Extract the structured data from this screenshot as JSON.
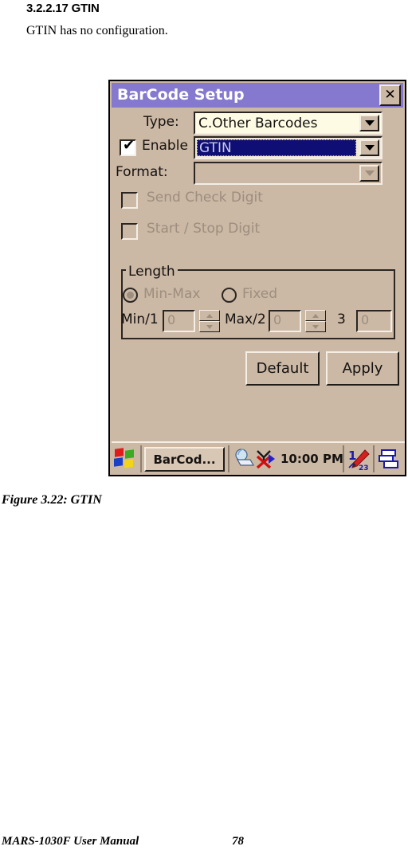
{
  "document": {
    "heading": "3.2.2.17 GTIN",
    "paragraph": "GTIN has no configuration.",
    "figure_caption": "Figure 3.22:  GTIN",
    "footer_left": "MARS-1030F User Manual",
    "footer_page": "78"
  },
  "dialog": {
    "title": "BarCode Setup",
    "close_label": "✕",
    "accent_titlebar": "#8578CF",
    "face_color": "#CBB8A5",
    "field_color": "#FDFBE3",
    "selection_color": "#0E0E74",
    "type": {
      "label": "Type:",
      "value": "C.Other Barcodes",
      "dropdown_icon": "chevron-down-icon"
    },
    "enable": {
      "label": "Enable",
      "checked": true,
      "check_glyph": "✔",
      "value": "GTIN",
      "dropdown_icon": "chevron-down-icon"
    },
    "format": {
      "label": "Format:",
      "value": "",
      "dropdown_icon": "chevron-down-icon",
      "disabled": true
    },
    "checkboxes": [
      {
        "label": "Send Check Digit",
        "checked": false,
        "disabled": true
      },
      {
        "label": "Start / Stop Digit",
        "checked": false,
        "disabled": true
      }
    ],
    "length_group": {
      "title": "Length",
      "radios": [
        {
          "label": "Min-Max",
          "selected": true,
          "disabled": true
        },
        {
          "label": "Fixed",
          "selected": false,
          "disabled": true
        }
      ],
      "fields": [
        {
          "label": "Min/1",
          "value": "0",
          "has_spinner": true,
          "disabled": true
        },
        {
          "label": "Max/2",
          "value": "0",
          "has_spinner": true,
          "disabled": true
        },
        {
          "label": "3",
          "value": "0",
          "has_spinner": false,
          "disabled": true
        }
      ]
    },
    "buttons": {
      "default_label": "Default",
      "apply_label": "Apply"
    }
  },
  "taskbar": {
    "start_icon": "windows-flag-icon",
    "task_button_label": "BarCod...",
    "tray": {
      "connection_icon": "desktop-connection-icon",
      "activesync_icon": "activesync-disconnected-icon",
      "play_icon": "play-triangle-icon",
      "clock": "10:00 PM",
      "input_panel_icon": "input-panel-pencil-icon",
      "windows_switch_icon": "window-switch-icon"
    }
  }
}
